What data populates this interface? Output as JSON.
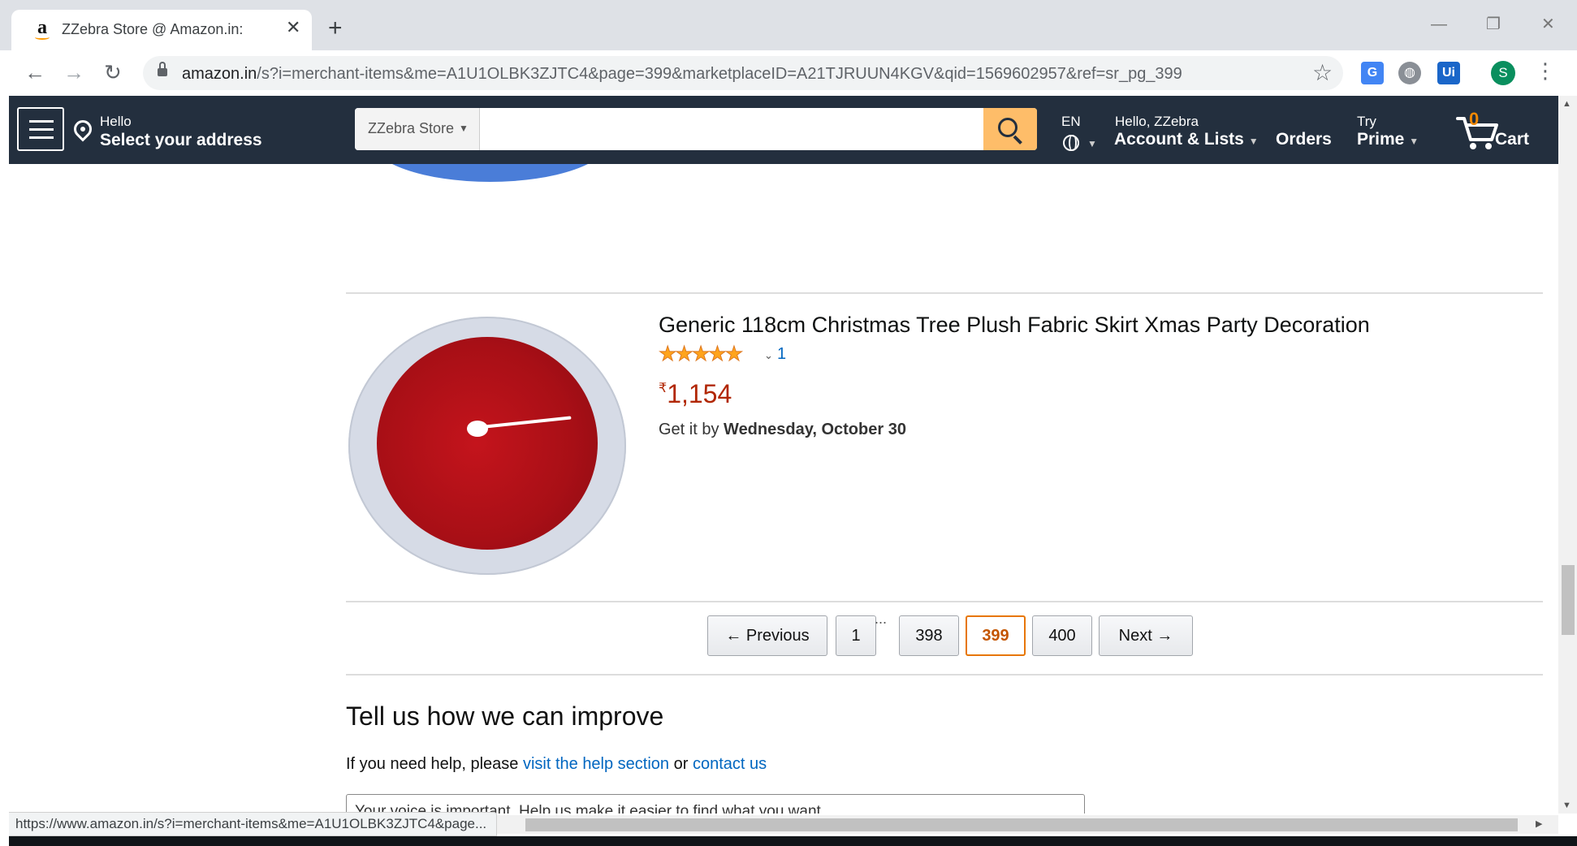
{
  "browser": {
    "tab_title": "ZZebra Store @ Amazon.in:",
    "new_tab_label": "+",
    "url_host": "amazon.in",
    "url_path": "/s?i=merchant-items&me=A1U1OLBK3ZJTC4&page=399&marketplaceID=A21TJRUUN4KGV&qid=1569602957&ref=sr_pg_399",
    "profile_initial": "S",
    "extension_ui_label": "Ui",
    "status_url": "https://www.amazon.in/s?i=merchant-items&me=A1U1OLBK3ZJTC4&page..."
  },
  "header": {
    "hello": "Hello",
    "select_address": "Select your address",
    "search_dept": "ZZebra Store",
    "search_placeholder": "",
    "language": "EN",
    "greeting": "Hello, ZZebra",
    "account_lists": "Account & Lists",
    "orders": "Orders",
    "try": "Try",
    "prime": "Prime",
    "cart_count": "0",
    "cart_label": "Cart",
    "colors": {
      "nav_bg": "#232f3e",
      "search_button": "#febd69",
      "cart_count": "#f08804"
    }
  },
  "product": {
    "title": "Generic 118cm Christmas Tree Plush Fabric Skirt Xmas Party Decoration",
    "rating": 5,
    "rating_count": "1",
    "currency_symbol": "₹",
    "price": "1,154",
    "delivery_prefix": "Get it by",
    "delivery_date": "Wednesday, October 30"
  },
  "pagination": {
    "previous": "← Previous",
    "next": "Next →",
    "gap": "...",
    "pages": [
      "1",
      "398",
      "399",
      "400"
    ],
    "current": "399"
  },
  "feedback": {
    "title": "Tell us how we can improve",
    "help_prefix": "If you need help, please",
    "help_link": "visit the help section",
    "or": "or",
    "contact_link": "contact us",
    "voice_text": "Your voice is important. Help us make it easier to find what you want..."
  }
}
